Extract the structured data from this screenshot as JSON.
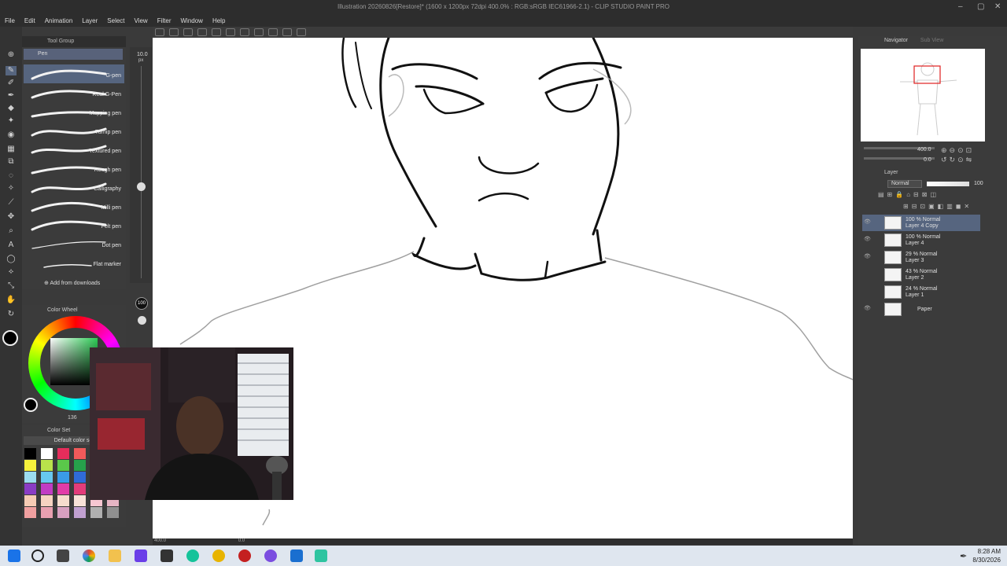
{
  "window": {
    "title": "Illustration 20260826[Restore]* (1600 x 1200px 72dpi 400.0% : RGB:sRGB IEC61966-2.1) - CLIP STUDIO PAINT PRO"
  },
  "menu": [
    "File",
    "Edit",
    "Animation",
    "Layer",
    "Select",
    "View",
    "Filter",
    "Window",
    "Help"
  ],
  "subtool": {
    "group_label": "Tool Group",
    "active_tab": "Pen",
    "brushes": [
      "G-pen",
      "Real G-Pen",
      "Mapping pen",
      "Turnip pen",
      "Textured pen",
      "Rough pen",
      "Calligraphy",
      "Milli pen",
      "Felt pen",
      "Dot pen",
      "Flat marker"
    ],
    "selected_brush": "G-pen",
    "add_label": "Add from downloads"
  },
  "brush_size": {
    "size_label": "10.0",
    "unit": "px",
    "opacity_label": "100"
  },
  "color_wheel": {
    "header": "Color Wheel",
    "readout": "136"
  },
  "color_set": {
    "header": "Color Set",
    "set_name": "Default color set",
    "swatches": [
      "#000000",
      "#ffffff",
      "#e52d5b",
      "#f05a5a",
      "#f48a60",
      "#f7a04c",
      "#f6f23c",
      "#b9e24b",
      "#5ac84a",
      "#26a14b",
      "#2e9e52",
      "#37b074",
      "#9cdcef",
      "#67c8ef",
      "#3a9be8",
      "#2f6bd8",
      "#3b4bc4",
      "#5b3cc4",
      "#8a3cc4",
      "#c13cc4",
      "#e23ca8",
      "#e23c7a",
      "#d43c5a",
      "#b53c3c",
      "#f6cbb4",
      "#f6d3c1",
      "#f6dccd",
      "#f7e2d8",
      "#f7c7d2",
      "#e6b5c4",
      "#f0a0a0",
      "#e8a0b0",
      "#d8a0c0",
      "#c0a0d0",
      "#b0b0b0",
      "#909090"
    ]
  },
  "navigator": {
    "header": "Navigator",
    "header2": "Sub View",
    "zoom": "400.0",
    "angle": "0.0"
  },
  "layers": {
    "header": "Layer",
    "blend_mode": "Normal",
    "opacity": "100",
    "items": [
      {
        "info": "100 % Normal",
        "name": "Layer 4 Copy",
        "selected": true,
        "visible": true
      },
      {
        "info": "100 % Normal",
        "name": "Layer 4",
        "selected": false,
        "visible": true
      },
      {
        "info": "29 % Normal",
        "name": "Layer 3",
        "selected": false,
        "visible": true
      },
      {
        "info": "43 % Normal",
        "name": "Layer 2",
        "selected": false,
        "visible": false
      },
      {
        "info": "24 % Normal",
        "name": "Layer 1",
        "selected": false,
        "visible": false
      },
      {
        "info": "",
        "name": "Paper",
        "selected": false,
        "visible": true
      }
    ]
  },
  "status": {
    "zoom": "400.0",
    "angle": "0.0"
  },
  "taskbar": {
    "time": "8:28 AM",
    "date": "8/30/2026"
  }
}
